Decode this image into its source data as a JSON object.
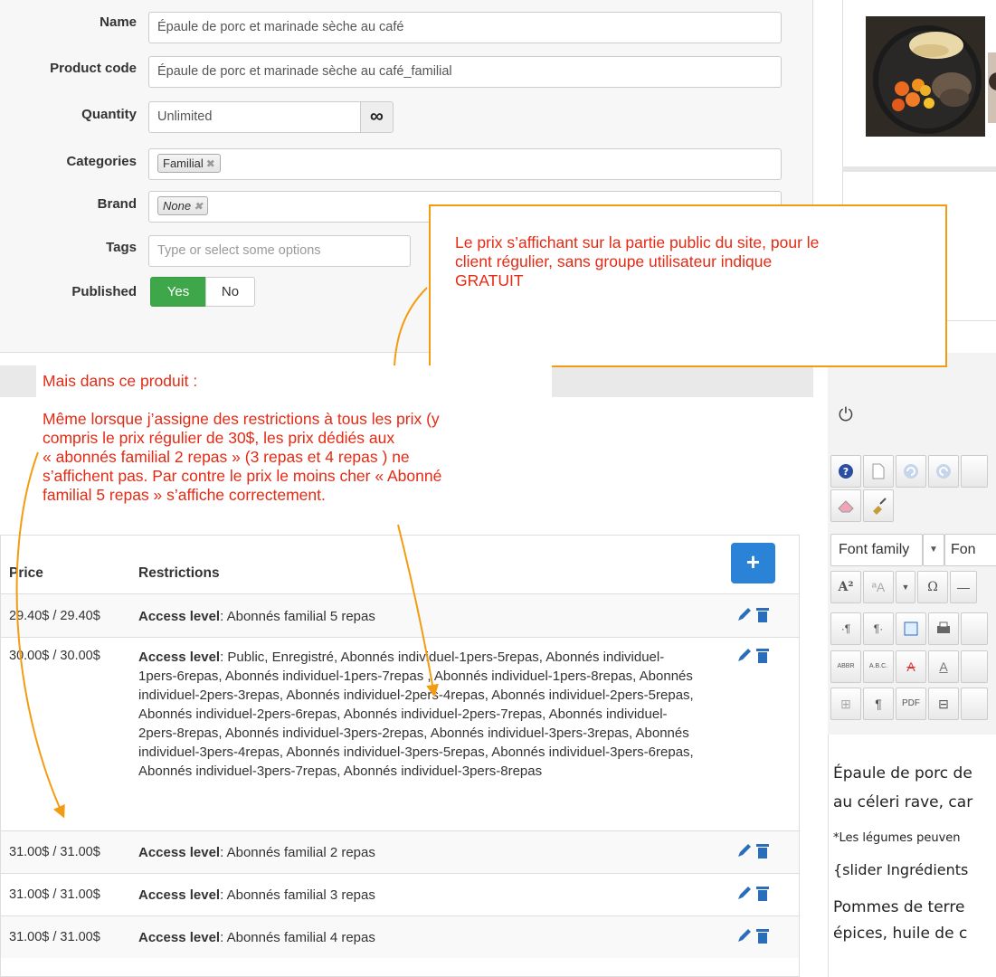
{
  "form": {
    "name_label": "Name",
    "name_value": "Épaule de porc et marinade sèche au café",
    "product_code_label": "Product code",
    "product_code_value": "Épaule de porc et marinade sèche au café_familial",
    "quantity_label": "Quantity",
    "quantity_value": "Unlimited",
    "quantity_unlimited_symbol": "∞",
    "categories_label": "Categories",
    "category_chip": "Familial",
    "brand_label": "Brand",
    "brand_chip": "None",
    "tags_label": "Tags",
    "tags_placeholder": "Type or select some options",
    "published_label": "Published",
    "published_yes": "Yes",
    "published_no": "No"
  },
  "callouts": {
    "top": [
      "Le prix s’affichant sur la partie public du site, pour le",
      "client régulier, sans groupe utilisateur indique",
      "GRATUIT"
    ],
    "left": [
      "Mais dans ce produit :",
      "",
      "Même lorsque j’assigne des restrictions à tous les prix (y",
      "compris le prix régulier de 30$, les prix dédiés aux",
      "« abonnés familial 2 repas » (3 repas et 4 repas ) ne",
      "s’affichent pas.  Par contre le prix le moins cher « Abonné",
      "familial 5 repas » s’affiche correctement."
    ]
  },
  "prices": {
    "col_price": "Price",
    "col_restrictions": "Restrictions",
    "add_symbol": "+",
    "access_level_label": "Access level",
    "rows": [
      {
        "price": "29.40$ / 29.40$",
        "levels": "Abonnés familial 5 repas"
      },
      {
        "price": "30.00$ / 30.00$",
        "levels": "Public, Enregistré, Abonnés individuel-1pers-5repas, Abonnés individuel-1pers-6repas, Abonnés individuel-1pers-7repas , Abonnés individuel-1pers-8repas, Abonnés individuel-2pers-3repas, Abonnés individuel-2pers-4repas, Abonnés individuel-2pers-5repas, Abonnés individuel-2pers-6repas, Abonnés individuel-2pers-7repas, Abonnés individuel-2pers-8repas, Abonnés individuel-3pers-2repas, Abonnés individuel-3pers-3repas, Abonnés individuel-3pers-4repas, Abonnés individuel-3pers-5repas, Abonnés individuel-3pers-6repas, Abonnés individuel-3pers-7repas, Abonnés individuel-3pers-8repas"
      },
      {
        "price": "31.00$ / 31.00$",
        "levels": "Abonnés familial 2 repas"
      },
      {
        "price": "31.00$ / 31.00$",
        "levels": "Abonnés familial 3 repas"
      },
      {
        "price": "31.00$ / 31.00$",
        "levels": "Abonnés familial 4 repas"
      }
    ]
  },
  "editor": {
    "power_symbol": "⏻",
    "font_family_label": "Font family",
    "font_size_label_partial": "Fon",
    "content": [
      "Épaule de porc de",
      "au céleri rave, car",
      "*Les légumes peuven",
      "{slider Ingrédients",
      "Pommes de terre",
      "épices, huile de c"
    ]
  },
  "colors": {
    "accent": "#2a83d6",
    "callout_text": "#e52a14",
    "callout_border": "#f39c12",
    "published_yes": "#3ea74a"
  }
}
